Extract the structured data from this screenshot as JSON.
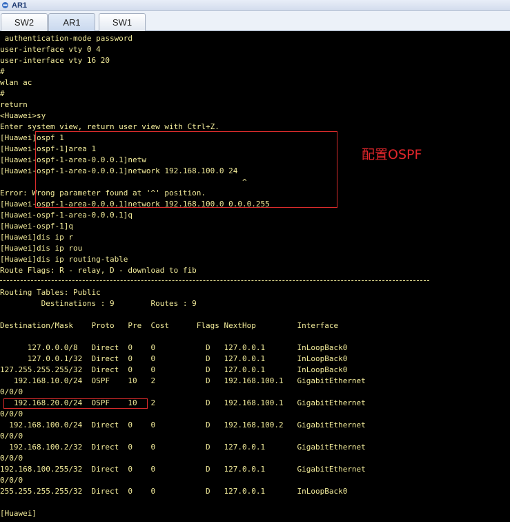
{
  "window": {
    "title": "AR1"
  },
  "tabs": [
    {
      "label": "SW2",
      "active": false
    },
    {
      "label": "AR1",
      "active": true
    },
    {
      "label": "SW1",
      "active": false
    }
  ],
  "terminal": {
    "lines": [
      " authentication-mode password",
      "user-interface vty 0 4",
      "user-interface vty 16 20",
      "#",
      "wlan ac",
      "#",
      "return",
      "<Huawei>sy",
      "Enter system view, return user view with Ctrl+Z.",
      "[Huawei]ospf 1",
      "[Huawei-ospf-1]area 1",
      "[Huawei-ospf-1-area-0.0.0.1]netw",
      "[Huawei-ospf-1-area-0.0.0.1]network 192.168.100.0 24",
      "                                                     ^",
      "Error: Wrong parameter found at '^' position.",
      "[Huawei-ospf-1-area-0.0.0.1]network 192.168.100.0 0.0.0.255",
      "[Huawei-ospf-1-area-0.0.0.1]q",
      "[Huawei-ospf-1]q",
      "[Huawei]dis ip r",
      "[Huawei]dis ip rou",
      "[Huawei]dis ip routing-table",
      "Route Flags: R - relay, D - download to fib",
      "",
      "Routing Tables: Public",
      "         Destinations : 9        Routes : 9",
      "",
      "Destination/Mask    Proto   Pre  Cost      Flags NextHop         Interface",
      "",
      "      127.0.0.0/8   Direct  0    0           D   127.0.0.1       InLoopBack0",
      "      127.0.0.1/32  Direct  0    0           D   127.0.0.1       InLoopBack0",
      "127.255.255.255/32  Direct  0    0           D   127.0.0.1       InLoopBack0",
      "   192.168.10.0/24  OSPF    10   2           D   192.168.100.1   GigabitEthernet",
      "0/0/0",
      "   192.168.20.0/24  OSPF    10   2           D   192.168.100.1   GigabitEthernet",
      "0/0/0",
      "  192.168.100.0/24  Direct  0    0           D   192.168.100.2   GigabitEthernet",
      "0/0/0",
      "  192.168.100.2/32  Direct  0    0           D   127.0.0.1       GigabitEthernet",
      "0/0/0",
      "192.168.100.255/32  Direct  0    0           D   127.0.0.1       GigabitEthernet",
      "0/0/0",
      "255.255.255.255/32  Direct  0    0           D   127.0.0.1       InLoopBack0",
      "",
      "[Huawei]"
    ]
  },
  "annotation": {
    "label": "配置OSPF"
  },
  "colors": {
    "terminal_text": "#f3ec9a",
    "terminal_bg": "#000000",
    "annotation": "#d92b2b"
  }
}
